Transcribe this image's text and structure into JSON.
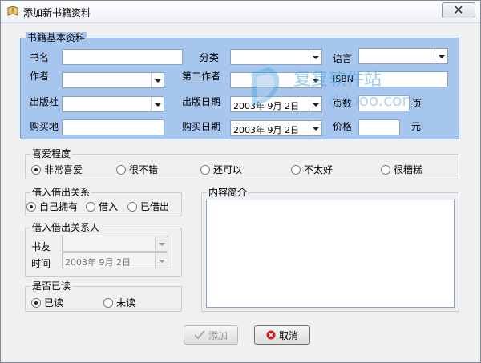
{
  "window": {
    "title": "添加新书籍资料",
    "close_glyph": "✕"
  },
  "basic": {
    "group_label": "书籍基本资料",
    "name_label": "书名",
    "category_label": "分类",
    "language_label": "语言",
    "author_label": "作者",
    "second_author_label": "第二作者",
    "isbn_label": "ISBN",
    "publisher_label": "出版社",
    "pub_date_label": "出版日期",
    "pub_date_value": "2003年 9月 2日",
    "pages_label": "页数",
    "pages_unit": "页",
    "buy_place_label": "购买地",
    "buy_date_label": "购买日期",
    "buy_date_value": "2003年 9月 2日",
    "price_label": "价格",
    "price_unit": "元"
  },
  "favor": {
    "group_label": "喜爱程度",
    "options": [
      "非常喜爱",
      "很不错",
      "还可以",
      "不太好",
      "很糟糕"
    ],
    "selected": "非常喜爱"
  },
  "lend": {
    "group_label": "借入借出关系",
    "options": [
      "自己拥有",
      "借入",
      "已借出"
    ],
    "selected": "自己拥有"
  },
  "lend_person": {
    "group_label": "借入借出关系人",
    "friend_label": "书友",
    "time_label": "时间",
    "time_value": "2003年 9月 2日"
  },
  "read": {
    "group_label": "是否已读",
    "options": [
      "已读",
      "未读"
    ],
    "selected": "已读"
  },
  "summary": {
    "group_label": "内容简介"
  },
  "buttons": {
    "add_label": "添加",
    "cancel_label": "取消"
  },
  "watermark": {
    "text1": "复复软件站",
    "text2": "ddooo.com"
  },
  "colors": {
    "basic_bg": "#a7c6ee",
    "window_bg": "#f0f0f0",
    "cancel_icon": "#c81e1e"
  }
}
